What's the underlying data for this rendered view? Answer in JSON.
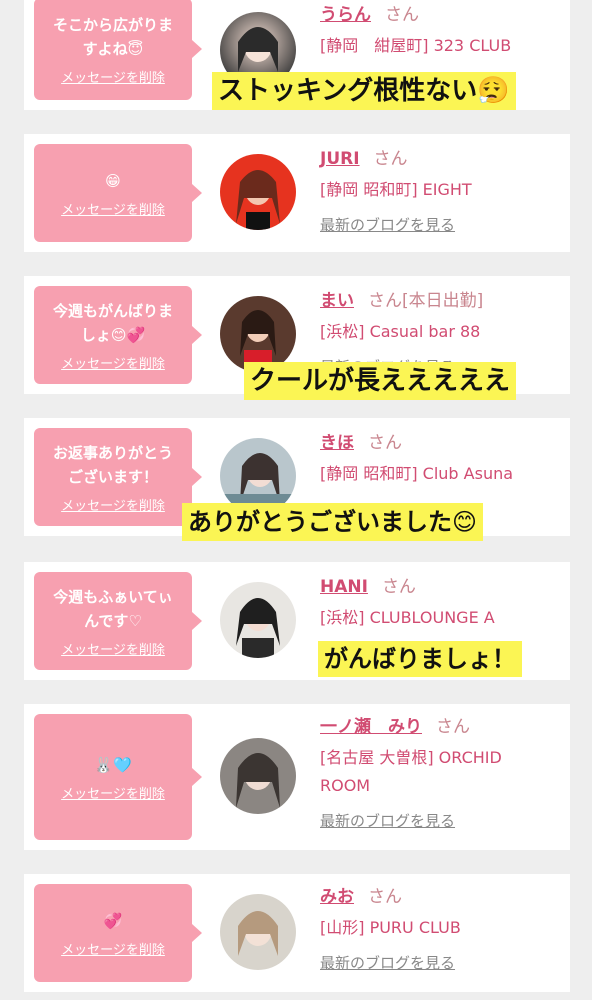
{
  "delete_label": "メッセージを削除",
  "blog_label": "最新のブログを見る",
  "san": "さん",
  "cards": [
    {
      "message": "そこから広がりますよね😇",
      "name": "うらん",
      "san": "さん",
      "location": "[静岡　紺屋町] 323 CLUB",
      "overlay": "ストッキング根性ない😮‍💨"
    },
    {
      "message": "😁",
      "name": "JURI",
      "san": "さん",
      "location": "[静岡 昭和町] EIGHT",
      "blog": "最新のブログを見る"
    },
    {
      "message": "今週もがんばりましょ😊💞",
      "name": "まい",
      "san": "さん[本日出勤]",
      "location": "[浜松] Casual bar 88",
      "overlay": "クールが長えええええ"
    },
    {
      "message": "お返事ありがとうございます！",
      "name": "きほ",
      "san": "さん",
      "location": "[静岡 昭和町] Club Asuna",
      "overlay": "ありがとうございました😊"
    },
    {
      "message": "今週もふぁいてぃんです♡",
      "name": "HANI",
      "san": "さん",
      "location": "[浜松] CLUBLOUNGE A",
      "overlay": "がんばりましょ！"
    },
    {
      "message": "🐰🩵",
      "name": "一ノ瀬　みり",
      "san": "さん",
      "location": "[名古屋 大曽根] ORCHID ROOM",
      "blog": "最新のブログを見る"
    },
    {
      "message": "💞",
      "name": "みお",
      "san": "さん",
      "location": "[山形] PURU CLUB",
      "blog": "最新のブログを見る"
    }
  ]
}
